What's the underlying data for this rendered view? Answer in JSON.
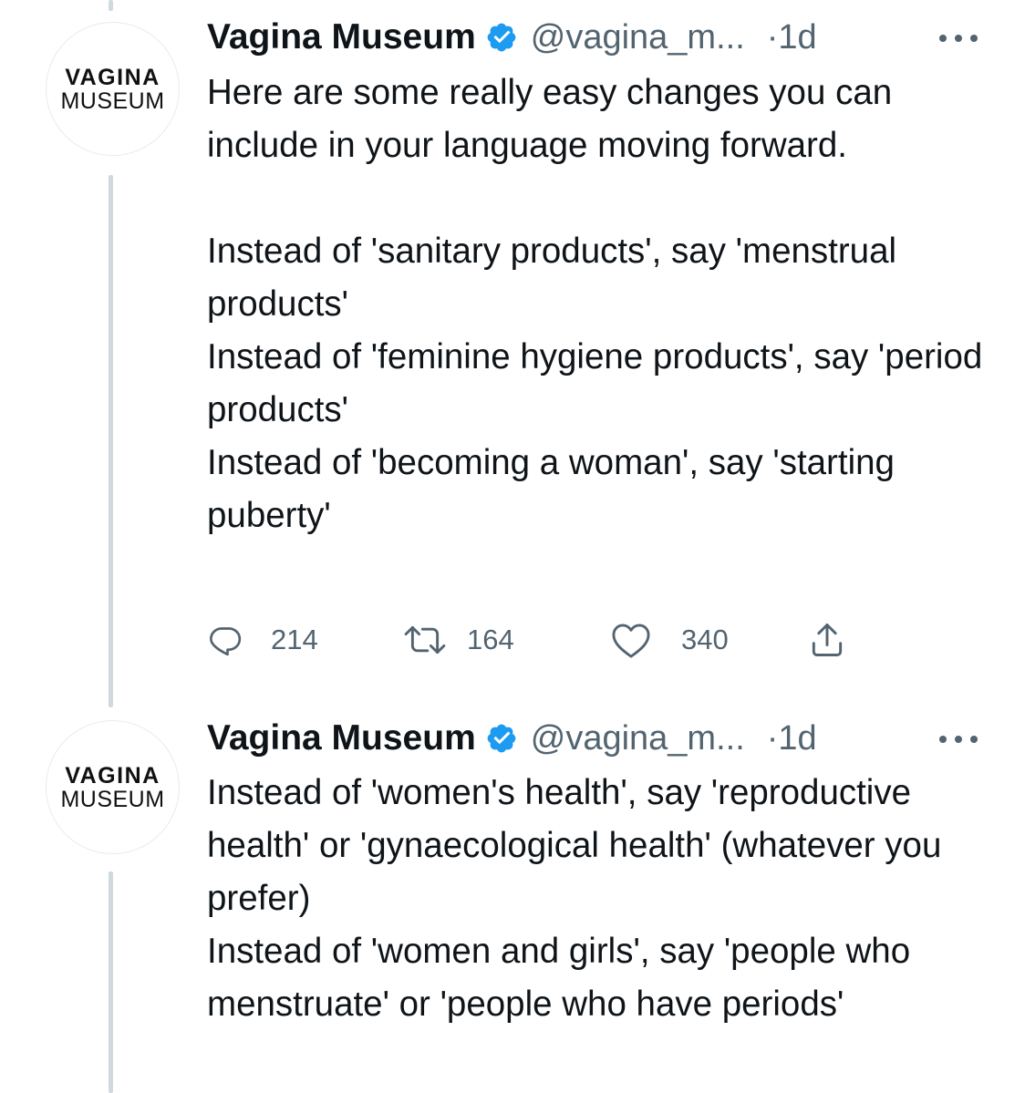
{
  "tweets": [
    {
      "avatar": {
        "line1": "VAGINA",
        "line2": "MUSEUM"
      },
      "name": "Vagina Museum",
      "handle": "@vagina_m...",
      "time": "·1d",
      "paragraphs": [
        "Here are some really easy changes you can include in your language moving forward.",
        "",
        "Instead of 'sanitary products', say 'menstrual products'",
        "Instead of 'feminine hygiene products', say 'period products'",
        "Instead of 'becoming a woman', say 'starting puberty'"
      ],
      "actions": {
        "replies": "214",
        "retweets": "164",
        "likes": "340"
      }
    },
    {
      "avatar": {
        "line1": "VAGINA",
        "line2": "MUSEUM"
      },
      "name": "Vagina Museum",
      "handle": "@vagina_m...",
      "time": "·1d",
      "paragraphs": [
        "Instead of 'women's health', say 'reproductive health' or 'gynaecological health' (whatever you prefer)",
        "Instead of 'women and girls', say 'people who menstruate' or 'people who have periods'"
      ]
    }
  ],
  "icons": {
    "verified": "verified-badge-icon",
    "more": "more-options-icon",
    "reply": "reply-icon",
    "retweet": "retweet-icon",
    "like": "heart-icon",
    "share": "share-icon"
  },
  "colors": {
    "verified": "#1d9bf0",
    "secondary_text": "#536471",
    "thread_line": "#cfd9de"
  }
}
